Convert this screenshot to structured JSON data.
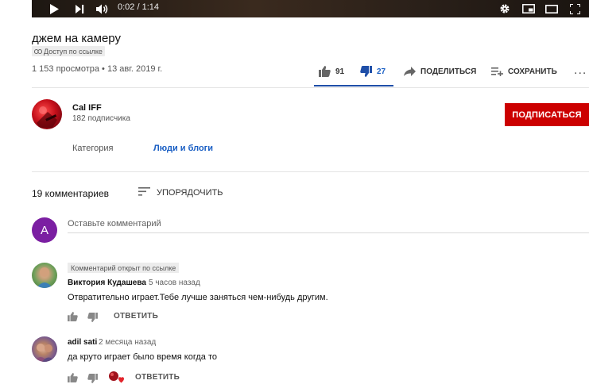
{
  "player": {
    "time": "0:02 / 1:14",
    "icons": [
      "play-icon",
      "next-icon",
      "volume-icon",
      "settings-icon",
      "miniplayer-icon",
      "theater-icon",
      "fullscreen-icon"
    ]
  },
  "video": {
    "title": "джем на камеру",
    "privacy": "Доступ по ссылке",
    "stats": "1 153 просмотра • 13 авг. 2019 г.",
    "likes": "91",
    "dislikes": "27",
    "share_label": "ПОДЕЛИТЬСЯ",
    "save_label": "СОХРАНИТЬ",
    "more_label": "..."
  },
  "channel": {
    "name": "Cal IFF",
    "subscribers": "182 подписчика",
    "subscribe_label": "ПОДПИСАТЬСЯ",
    "category_label": "Категория",
    "category_value": "Люди и блоги"
  },
  "comments": {
    "count_label": "19 комментариев",
    "sort_label": "УПОРЯДОЧИТЬ",
    "my_avatar_letter": "A",
    "input_placeholder": "Оставьте комментарий",
    "items": [
      {
        "badge": "Комментарий открыт по ссылке",
        "author": "Виктория Кудашева",
        "time": "5 часов назад",
        "text": "Отвратительно играет.Тебе лучше заняться чем-нибудь другим.",
        "reply_label": "ОТВЕТИТЬ"
      },
      {
        "author": "adil sati",
        "time": "2 месяца назад",
        "text": "да круто играет было время когда то",
        "reply_label": "ОТВЕТИТЬ"
      }
    ]
  },
  "colors": {
    "accent_blue": "#1a5fc4",
    "subscribe_red": "#cc0000",
    "avatar_purple": "#7b1fa2"
  }
}
